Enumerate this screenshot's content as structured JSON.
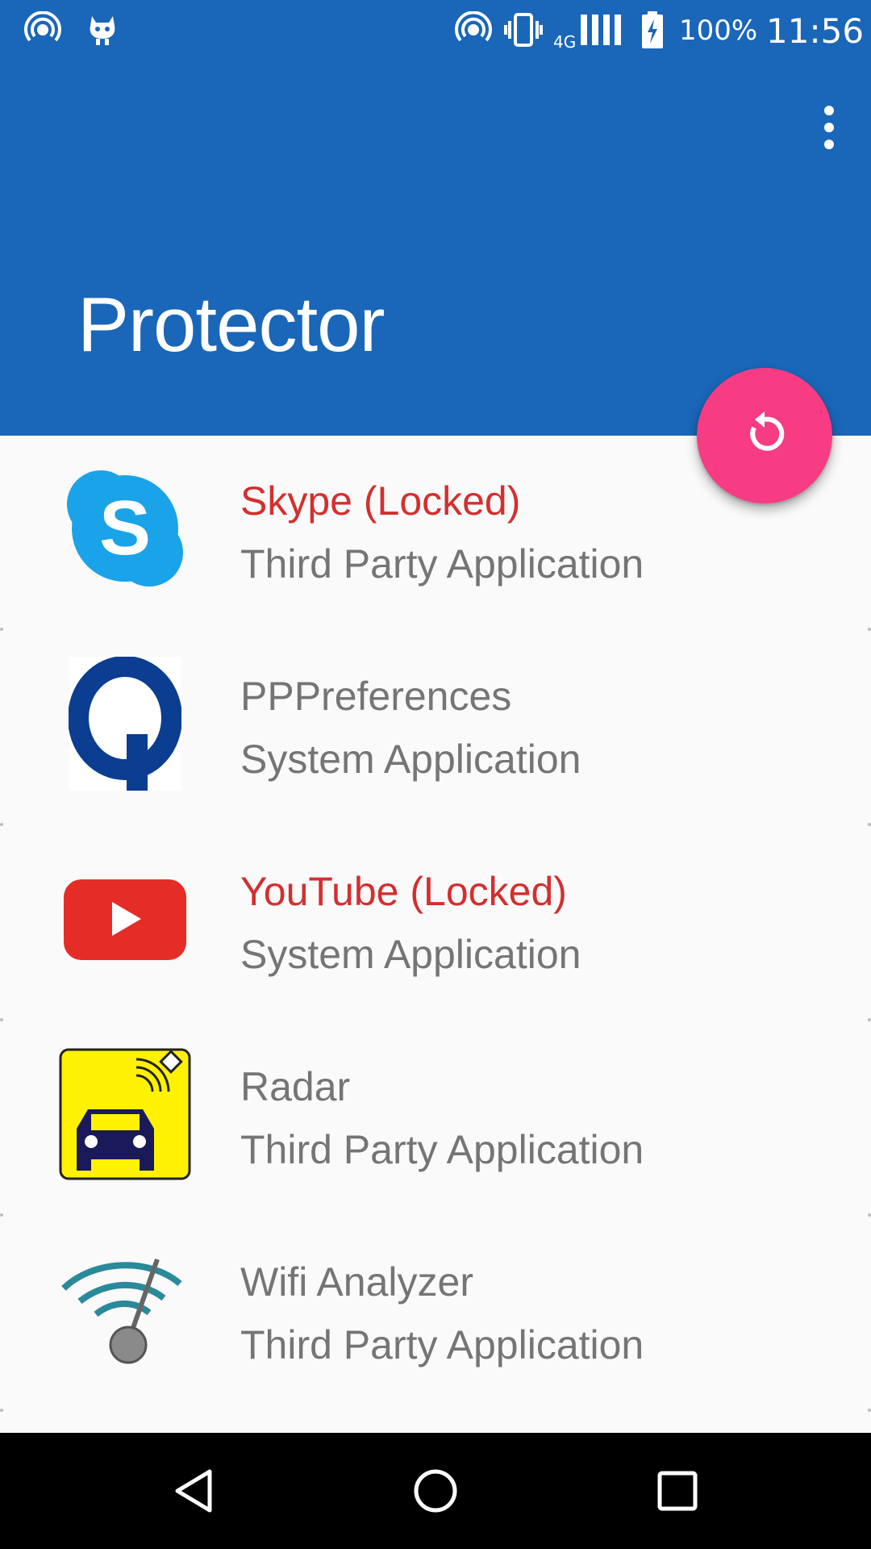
{
  "status_bar": {
    "network_type": "4G",
    "battery_percent": "100%",
    "time": "11:56"
  },
  "app_bar": {
    "title": "Protector"
  },
  "apps": [
    {
      "name": "Skype (Locked)",
      "type": "Third Party Application",
      "locked": true,
      "icon": "skype-icon"
    },
    {
      "name": "PPPreferences",
      "type": "System Application",
      "locked": false,
      "icon": "pppreferences-icon"
    },
    {
      "name": "YouTube (Locked)",
      "type": "System Application",
      "locked": true,
      "icon": "youtube-icon"
    },
    {
      "name": "Radar",
      "type": "Third Party Application",
      "locked": false,
      "icon": "radar-icon"
    },
    {
      "name": "Wifi Analyzer",
      "type": "Third Party Application",
      "locked": false,
      "icon": "wifi-analyzer-icon"
    }
  ],
  "colors": {
    "primary": "#1a66b8",
    "accent": "#f73c84",
    "locked_text": "#d32f2f",
    "secondary_text": "#757575"
  }
}
